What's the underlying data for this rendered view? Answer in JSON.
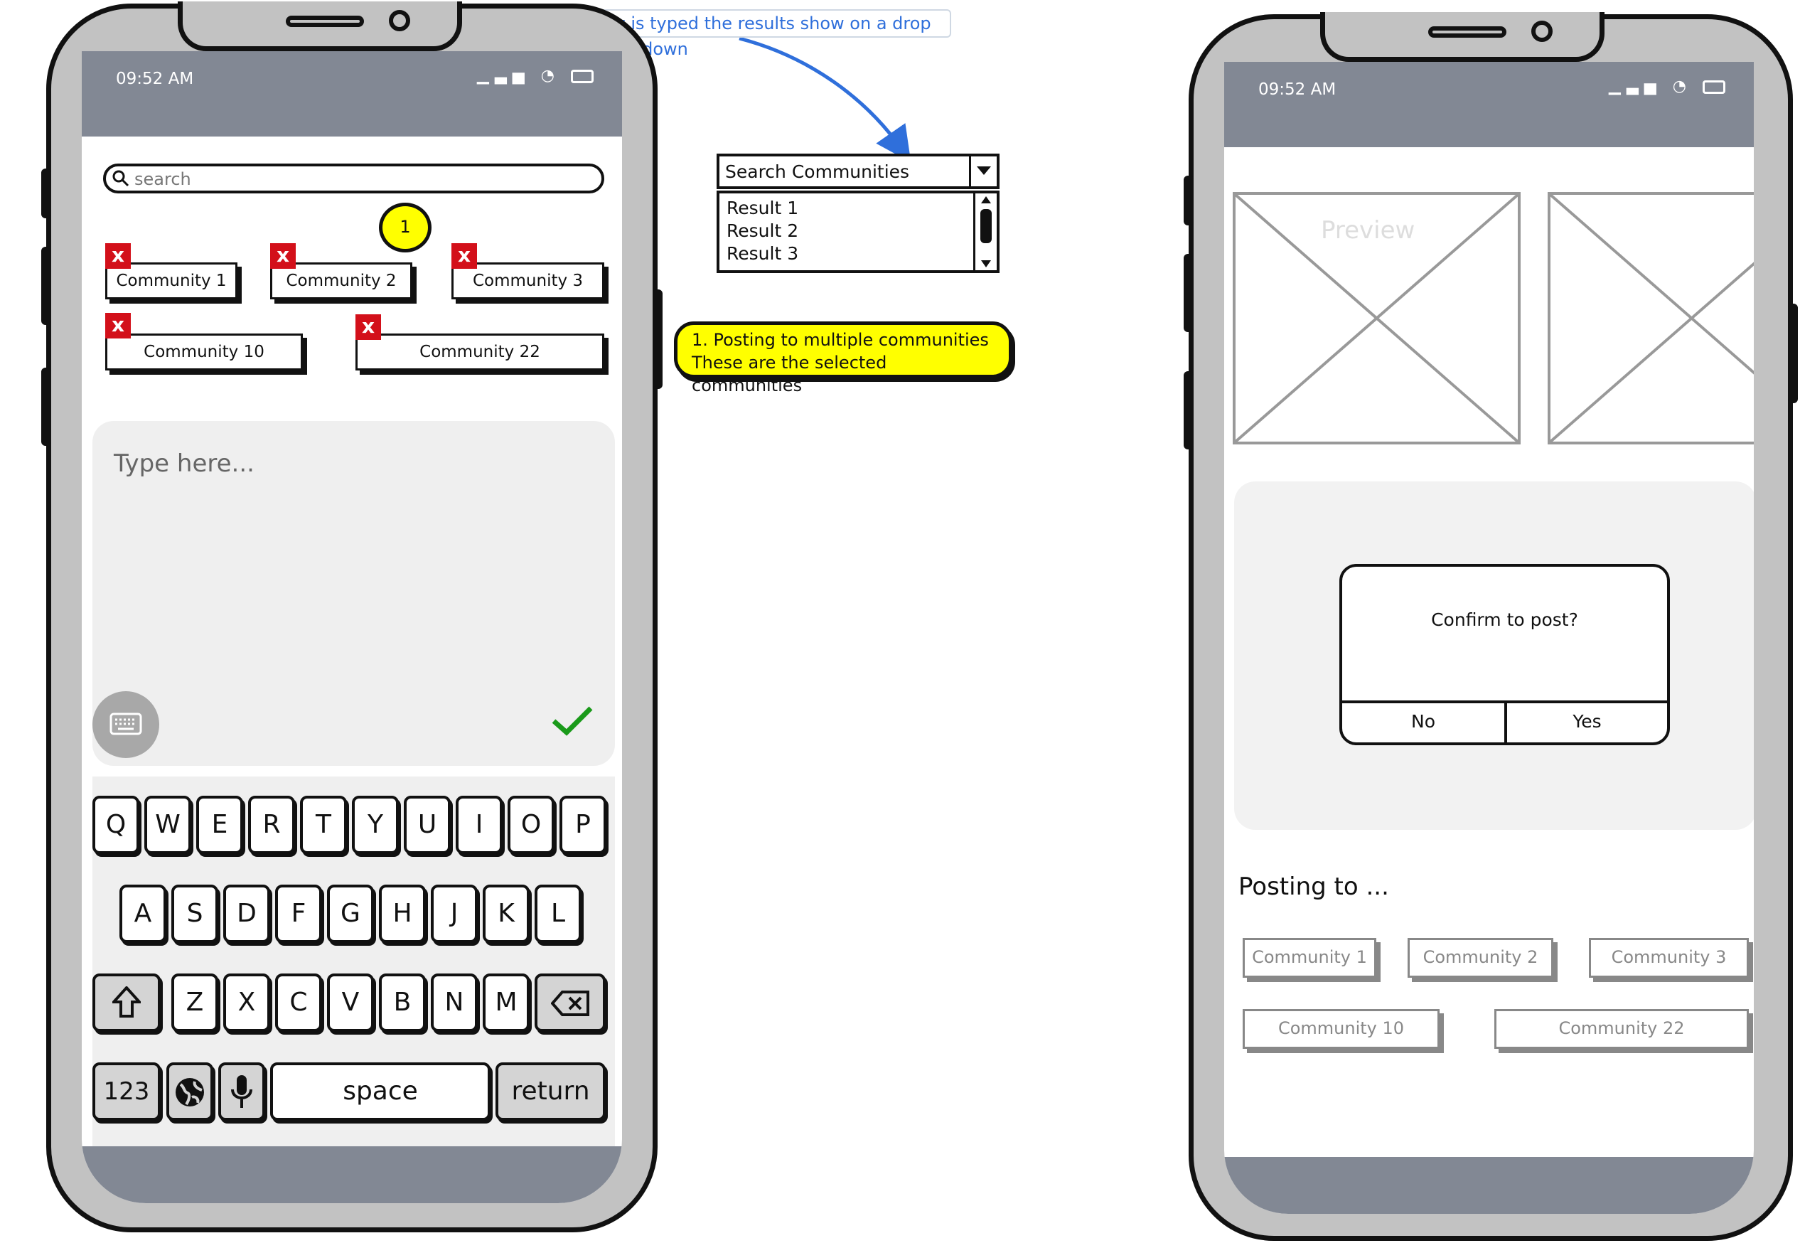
{
  "annotations": {
    "dropdown_note": "When name of community is typed the results show on a drop down",
    "badge_number": "1",
    "selected_note_line1": "1. Posting to multiple communities",
    "selected_note_line2": "These are the selected communities",
    "accent_blue": "#2f6fdb",
    "note_yellow": "#ffff00"
  },
  "dropdown": {
    "label": "Search Communities",
    "results": [
      "Result 1",
      "Result 2",
      "Result 3"
    ]
  },
  "left_phone": {
    "time": "09:52 AM",
    "search": {
      "placeholder": "search"
    },
    "selected_communities": [
      "Community 1",
      "Community 2",
      "Community 3",
      "Community 10",
      "Community 22"
    ],
    "remove_icon": "x",
    "compose": {
      "placeholder": "Type here..."
    },
    "keyboard": {
      "row1": [
        "Q",
        "W",
        "E",
        "R",
        "T",
        "Y",
        "U",
        "I",
        "O",
        "P"
      ],
      "row2": [
        "A",
        "S",
        "D",
        "F",
        "G",
        "H",
        "J",
        "K",
        "L"
      ],
      "row3": [
        "Z",
        "X",
        "C",
        "V",
        "B",
        "N",
        "M"
      ],
      "numbers": "123",
      "space": "space",
      "return": "return"
    }
  },
  "right_phone": {
    "time": "09:52 AM",
    "preview_label": "Preview",
    "dialog": {
      "message": "Confirm to post?",
      "no": "No",
      "yes": "Yes"
    },
    "posting_title": "Posting to ...",
    "posting_communities": [
      "Community 1",
      "Community 2",
      "Community 3",
      "Community 10",
      "Community 22"
    ]
  },
  "colors": {
    "frame": "#c2c2c2",
    "status_bar": "#828894",
    "remove_red": "#d3101a",
    "check_green": "#1a9a1a"
  }
}
